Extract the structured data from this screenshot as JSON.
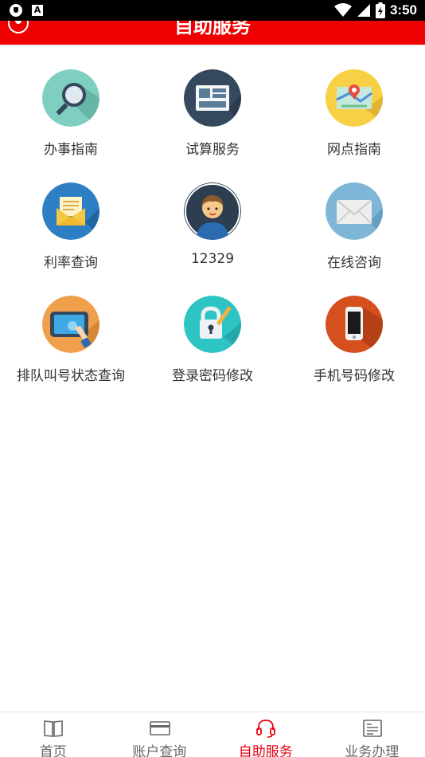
{
  "status_bar": {
    "time": "3:50"
  },
  "header": {
    "title": "自助服务"
  },
  "grid": {
    "items": [
      {
        "label": "办事指南",
        "icon": "magnifier-icon",
        "color": "#7fcfc0"
      },
      {
        "label": "试算服务",
        "icon": "dashboard-icon",
        "color": "#34495e"
      },
      {
        "label": "网点指南",
        "icon": "map-pin-icon",
        "color": "#f7d046"
      },
      {
        "label": "利率查询",
        "icon": "envelope-letter-icon",
        "color": "#2e7ec4"
      },
      {
        "label": "12329",
        "icon": "service-agent-icon",
        "color": "#2c3e50"
      },
      {
        "label": "在线咨询",
        "icon": "mail-icon",
        "color": "#7fb6d8"
      },
      {
        "label": "排队叫号状态查询",
        "icon": "tablet-touch-icon",
        "color": "#f0a04b"
      },
      {
        "label": "登录密码修改",
        "icon": "lock-icon",
        "color": "#2ec4c4"
      },
      {
        "label": "手机号码修改",
        "icon": "phone-icon",
        "color": "#d64f1f"
      }
    ]
  },
  "bottom_nav": {
    "active_color": "#e60012",
    "items": [
      {
        "label": "首页",
        "icon": "book-icon"
      },
      {
        "label": "账户查询",
        "icon": "card-icon"
      },
      {
        "label": "自助服务",
        "icon": "headset-icon",
        "active": true
      },
      {
        "label": "业务办理",
        "icon": "form-icon"
      }
    ]
  }
}
